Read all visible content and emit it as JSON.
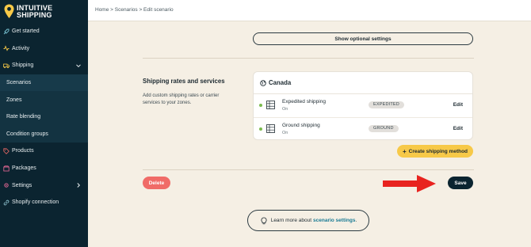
{
  "brand": {
    "line1": "INTUITIVE",
    "line2": "SHIPPING"
  },
  "sidebar": {
    "items": [
      {
        "label": "Get started",
        "icon": "rocket-icon"
      },
      {
        "label": "Activity",
        "icon": "pulse-icon"
      },
      {
        "label": "Shipping",
        "icon": "truck-icon",
        "expanded": true
      },
      {
        "label": "Scenarios"
      },
      {
        "label": "Zones"
      },
      {
        "label": "Rate blending"
      },
      {
        "label": "Condition groups"
      },
      {
        "label": "Products",
        "icon": "tag-icon"
      },
      {
        "label": "Packages",
        "icon": "box-icon"
      },
      {
        "label": "Settings",
        "icon": "gear-icon"
      },
      {
        "label": "Shopify connection",
        "icon": "link-icon"
      }
    ]
  },
  "breadcrumb": "Home > Scenarios > Edit scenario",
  "optional_settings_label": "Show optional settings",
  "section": {
    "title": "Shipping rates and services",
    "description": "Add custom shipping rates or carrier services to your zones."
  },
  "zone": {
    "name": "Canada",
    "methods": [
      {
        "name": "Expedited shipping",
        "status": "On",
        "tag": "EXPEDITED",
        "edit": "Edit"
      },
      {
        "name": "Ground shipping",
        "status": "On",
        "tag": "GROUND",
        "edit": "Edit"
      }
    ]
  },
  "create_method_label": "Create shipping method",
  "delete_label": "Delete",
  "save_label": "Save",
  "learn_more": {
    "prefix": "Learn more about",
    "link": "scenario settings",
    "suffix": "."
  },
  "colors": {
    "sidebar": "#0b2430",
    "background": "#f5efe4",
    "accent_yellow": "#f7c948",
    "delete_red": "#f06b67",
    "arrow_red": "#e8231f",
    "link": "#1a7b94"
  }
}
